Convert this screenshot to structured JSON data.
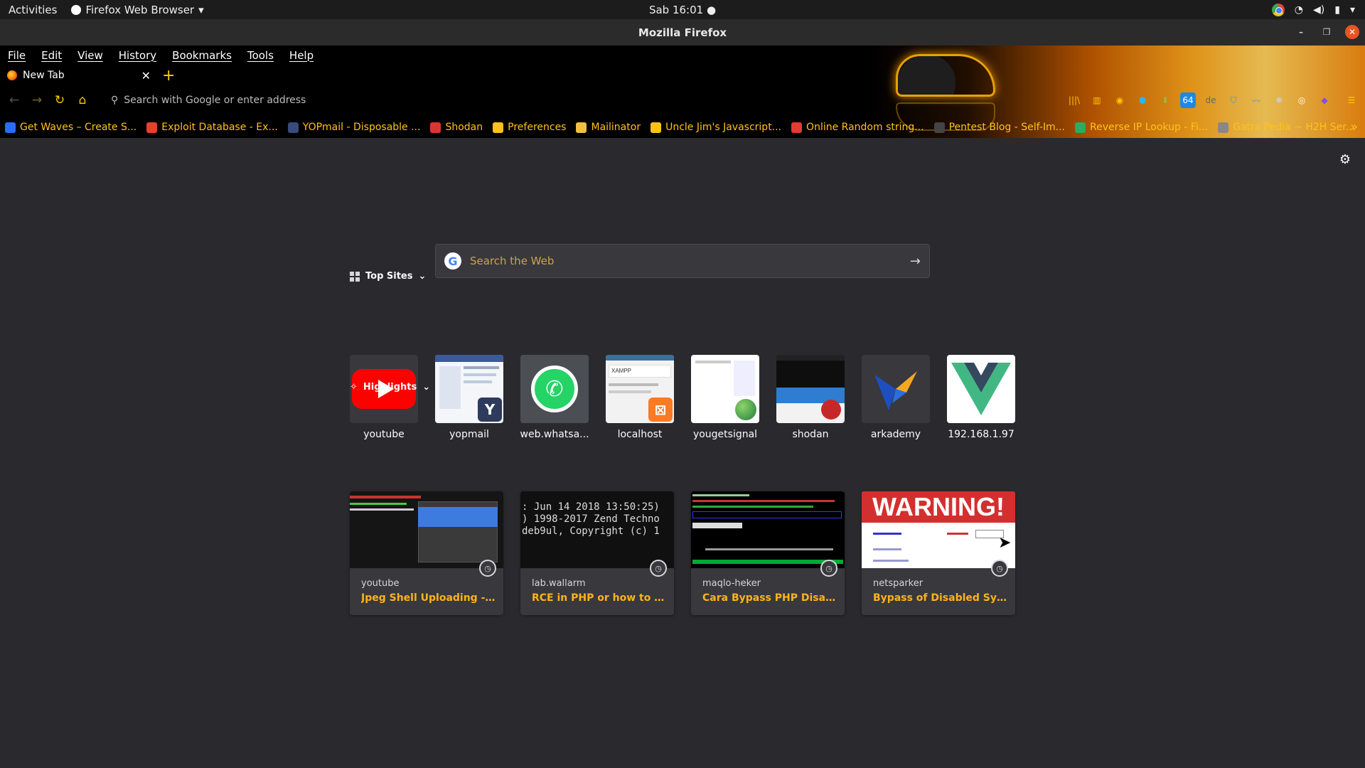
{
  "gnome": {
    "activities": "Activities",
    "app_name": "Firefox Web Browser",
    "clock": "Sab 16:01 ●"
  },
  "window": {
    "title": "Mozilla Firefox"
  },
  "menu": [
    "File",
    "Edit",
    "View",
    "History",
    "Bookmarks",
    "Tools",
    "Help"
  ],
  "tab": {
    "title": "New Tab"
  },
  "urlbar": {
    "placeholder": "Search with Google or enter address"
  },
  "bookmarks": [
    {
      "label": "Get Waves – Create S...",
      "color": "#2b6bff"
    },
    {
      "label": "Exploit Database - Ex...",
      "color": "#e0442b"
    },
    {
      "label": "YOPmail - Disposable ...",
      "color": "#3a4a7a"
    },
    {
      "label": "Shodan",
      "color": "#d33"
    },
    {
      "label": "Preferences",
      "color": "#ffc21a"
    },
    {
      "label": "Mailinator",
      "color": "#f0c040"
    },
    {
      "label": "Uncle Jim's Javascript...",
      "color": "#ffc21a"
    },
    {
      "label": "Online Random string...",
      "color": "#e53935"
    },
    {
      "label": "Pentest Blog - Self-Im...",
      "color": "#444"
    },
    {
      "label": "Reverse IP Lookup - Fi...",
      "color": "#27ae60"
    },
    {
      "label": "Gatra Pedia ~ H2H Ser...",
      "color": "#888"
    }
  ],
  "search": {
    "placeholder": "Search the Web"
  },
  "top_sites": {
    "header": "Top Sites",
    "sites": [
      {
        "label": "youtube"
      },
      {
        "label": "yopmail"
      },
      {
        "label": "web.whatsa..."
      },
      {
        "label": "localhost"
      },
      {
        "label": "yougetsignal"
      },
      {
        "label": "shodan"
      },
      {
        "label": "arkademy"
      },
      {
        "label": "192.168.1.97"
      }
    ]
  },
  "highlights": {
    "header": "Highlights",
    "cards": [
      {
        "host": "youtube",
        "title": "Jpeg Shell Uploading - E..."
      },
      {
        "host": "lab.wallarm",
        "title": "RCE in PHP or how to byp...",
        "thumb_lines": [
          ": Jun 14 2018 13:50:25)",
          ") 1998-2017 Zend Techno",
          "deb9ul, Copyright (c) 1"
        ]
      },
      {
        "host": "maqlo-heker",
        "title": "Cara Bypass PHP Disable ..."
      },
      {
        "host": "netsparker",
        "title": "Bypass of Disabled Syste...",
        "thumb_text": "WARNING!"
      }
    ]
  },
  "colors": {
    "accent": "#ffcc00",
    "bookmark_text": "#ffc21a",
    "highlight_title": "#ffb31a",
    "background": "#2a2a2e"
  }
}
